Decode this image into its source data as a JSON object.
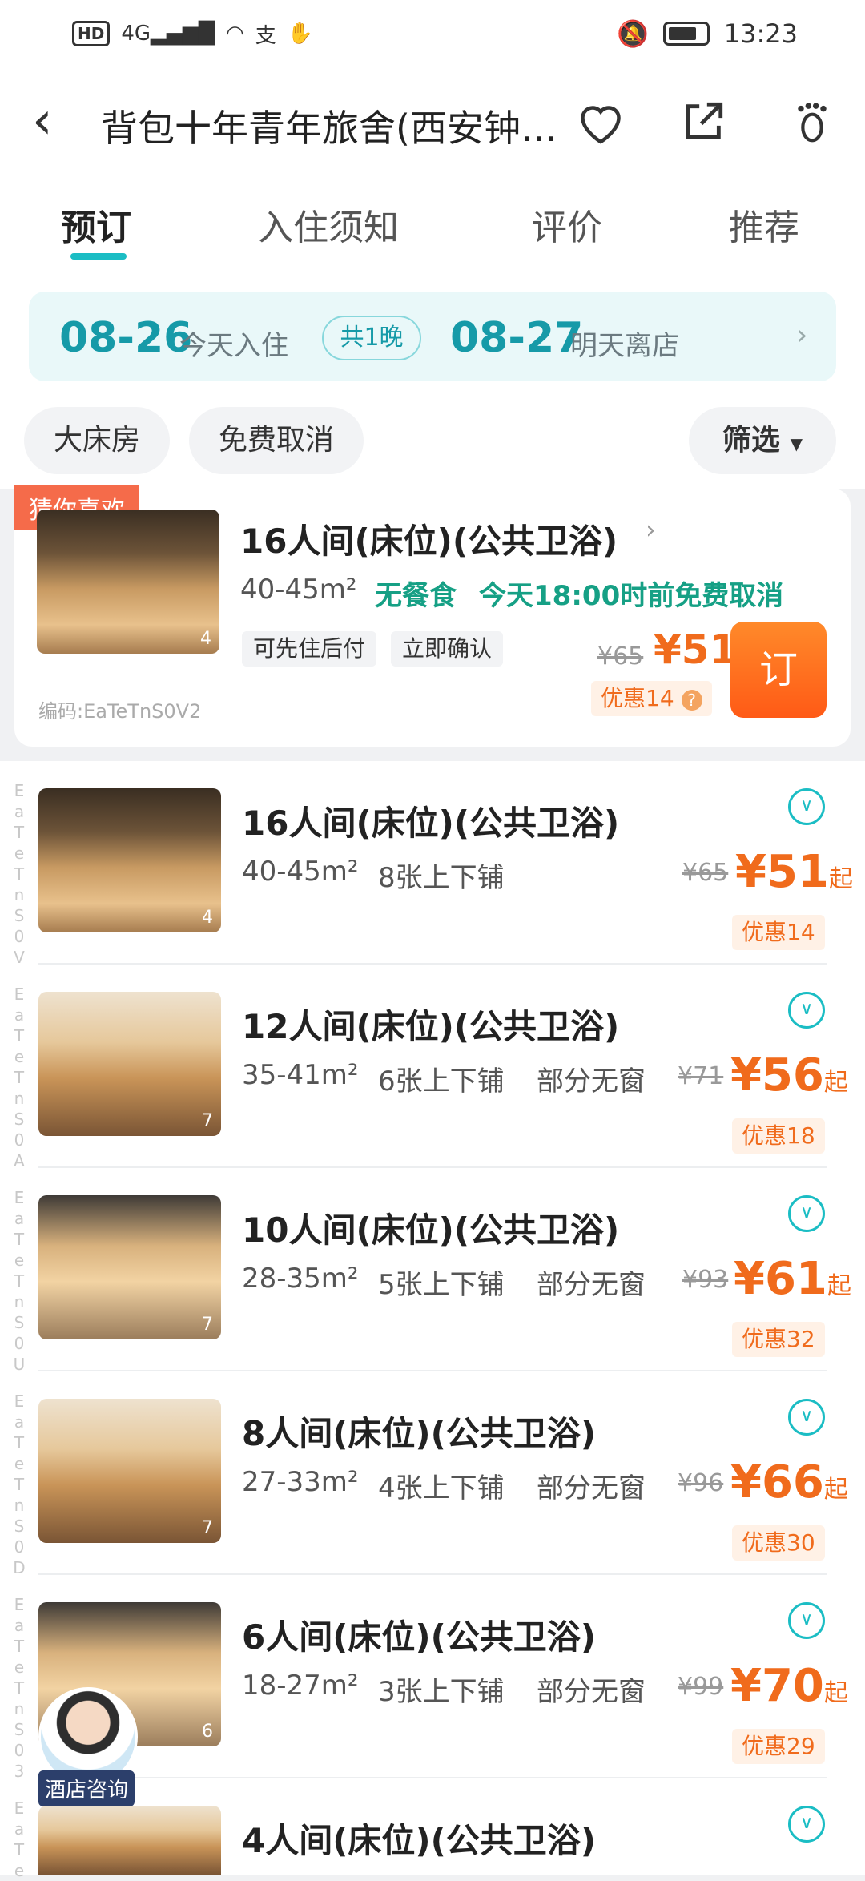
{
  "status_bar": {
    "left": "HD 4G",
    "time": "13:23"
  },
  "header": {
    "title": "背包十年青年旅舍(西安钟…"
  },
  "tabs": [
    {
      "label": "预订",
      "active": true
    },
    {
      "label": "入住须知"
    },
    {
      "label": "评价"
    },
    {
      "label": "推荐"
    }
  ],
  "dates": {
    "checkin": "08-26",
    "checkin_label": "今天入住",
    "nights": "共1晚",
    "checkout": "08-27",
    "checkout_label": "明天离店"
  },
  "filters": {
    "chip1": "大床房",
    "chip2": "免费取消",
    "filter": "筛选"
  },
  "featured": {
    "tag": "猜你喜欢",
    "photo_count": "4",
    "title": "16人间(床位)(公共卫浴)",
    "area": "40-45m²",
    "meal": "无餐食",
    "cancel": "今天18:00时前免费取消",
    "tag1": "可先住后付",
    "tag2": "立即确认",
    "code": "编码:EaTeTnS0V2",
    "old_price": "¥65",
    "price": "¥51",
    "discount": "优惠14",
    "book": "订"
  },
  "rooms": [
    {
      "title": "16人间(床位)(公共卫浴)",
      "area": "40-45m²",
      "beds": "8张上下铺",
      "window": "",
      "old_price": "¥65",
      "price": "¥51",
      "suffix": "起",
      "discount": "优惠14",
      "photo_count": "4",
      "code": "EaTeTnS0V"
    },
    {
      "title": "12人间(床位)(公共卫浴)",
      "area": "35-41m²",
      "beds": "6张上下铺",
      "window": "部分无窗",
      "old_price": "¥71",
      "price": "¥56",
      "suffix": "起",
      "discount": "优惠18",
      "photo_count": "7",
      "code": "EaTeTnS0A"
    },
    {
      "title": "10人间(床位)(公共卫浴)",
      "area": "28-35m²",
      "beds": "5张上下铺",
      "window": "部分无窗",
      "old_price": "¥93",
      "price": "¥61",
      "suffix": "起",
      "discount": "优惠32",
      "photo_count": "7",
      "code": "EaTeTnS0U"
    },
    {
      "title": "8人间(床位)(公共卫浴)",
      "area": "27-33m²",
      "beds": "4张上下铺",
      "window": "部分无窗",
      "old_price": "¥96",
      "price": "¥66",
      "suffix": "起",
      "discount": "优惠30",
      "photo_count": "7",
      "code": "EaTeTnS0D"
    },
    {
      "title": "6人间(床位)(公共卫浴)",
      "area": "18-27m²",
      "beds": "3张上下铺",
      "window": "部分无窗",
      "old_price": "¥99",
      "price": "¥70",
      "suffix": "起",
      "discount": "优惠29",
      "photo_count": "6",
      "code": "EaTeTnS03"
    },
    {
      "title": "4人间(床位)(公共卫浴)",
      "area": "",
      "beds": "",
      "window": "",
      "old_price": "",
      "price": "",
      "suffix": "",
      "discount": "",
      "photo_count": "",
      "code": "EaTe"
    }
  ],
  "consult": {
    "label": "酒店咨询"
  }
}
